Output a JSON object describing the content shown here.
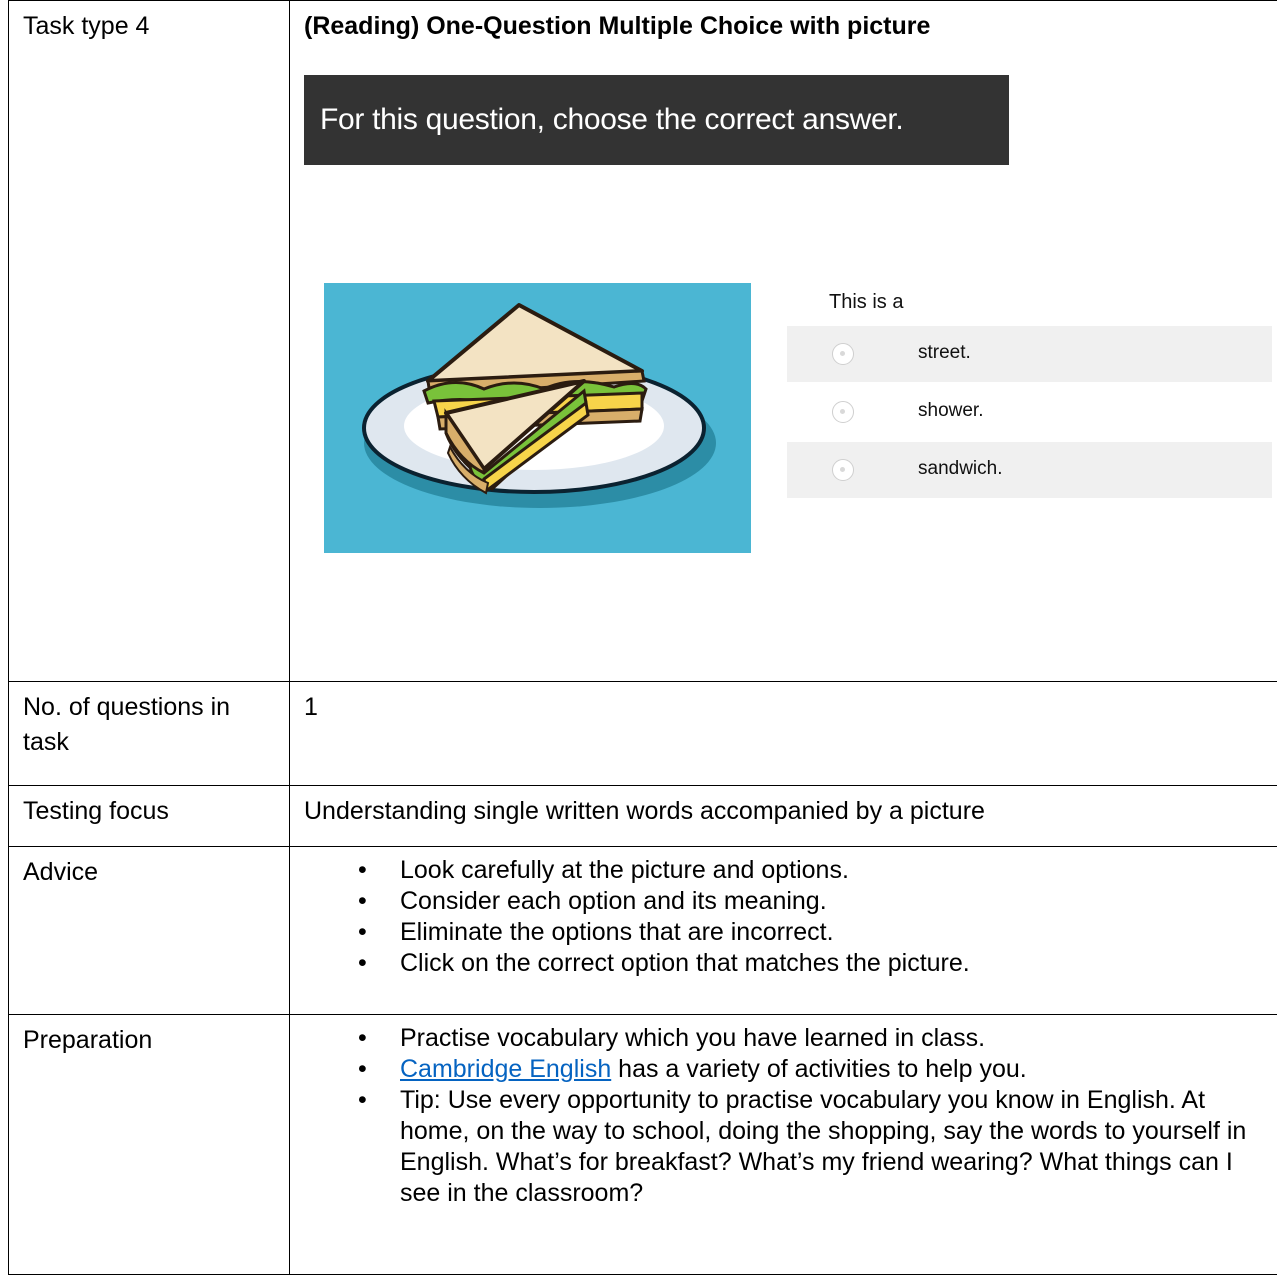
{
  "task_type": {
    "label": "Task type 4",
    "title": "(Reading) One-Question Multiple Choice with picture",
    "instruction": "For this question, choose the correct answer.",
    "image": "sandwich-on-plate",
    "question_stem": "This is a",
    "options": [
      "street.",
      "shower.",
      "sandwich."
    ],
    "image_bg_color": "#4bb6d3",
    "prompt_bar_color": "#333333"
  },
  "rows": {
    "questions": {
      "label_line1": "No. of questions in",
      "label_line2": "task",
      "value": "1"
    },
    "focus": {
      "label": "Testing focus",
      "value": "Understanding single written words accompanied by a picture"
    },
    "advice": {
      "label": "Advice",
      "items": [
        "Look carefully at the picture and options.",
        "Consider each option and its meaning.",
        "Eliminate the options that are incorrect.",
        "Click on the correct option that matches the picture."
      ]
    },
    "preparation": {
      "label": "Preparation",
      "item1": "Practise vocabulary which you have learned in class.",
      "item2_link": "Cambridge English",
      "item2_rest": " has a variety of activities to help you.",
      "item3": "Tip: Use every opportunity to practise vocabulary you know in English. At home, on the way to school, doing the shopping, say the words to yourself in English. What’s for breakfast? What’s my friend wearing? What things can I see in the classroom?"
    }
  }
}
